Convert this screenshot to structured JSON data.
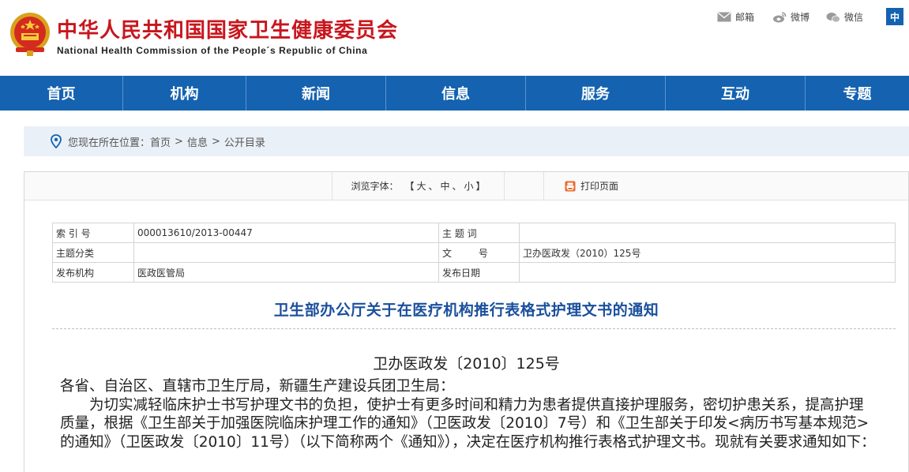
{
  "header": {
    "title": "中华人民共和国国家卫生健康委员会",
    "subtitle": "National Health Commission of the People´s Republic of China",
    "share": {
      "mail": "邮箱",
      "weibo": "微博",
      "wechat": "微信"
    },
    "lang": "中"
  },
  "nav": [
    "首页",
    "机构",
    "新闻",
    "信息",
    "服务",
    "互动",
    "专题"
  ],
  "breadcrumb": {
    "prefix": "您现在所在位置：",
    "items": [
      "首页",
      "信息",
      "公开目录"
    ],
    "separator": ">"
  },
  "toolbar": {
    "font_label": "浏览字体：",
    "open_bracket": "【",
    "large": "大",
    "medium": "中",
    "small": "小",
    "close_bracket": "】",
    "sep": "、",
    "print": "打印页面"
  },
  "meta": {
    "index_label": "索 引 号",
    "index_value": "000013610/2013-00447",
    "keyword_label": "主 题 词",
    "keyword_value": "",
    "category_label": "主题分类",
    "category_value": "",
    "docno_label": "文 号",
    "docno_value": "卫办医政发（2010）125号",
    "publisher_label": "发布机构",
    "publisher_value": "医政医管局",
    "date_label": "发布日期",
    "date_value": ""
  },
  "article": {
    "title": "卫生部办公厅关于在医疗机构推行表格式护理文书的通知",
    "doc_number": "卫办医政发〔2010〕125号",
    "greeting": "各省、自治区、直辖市卫生厅局，新疆生产建设兵团卫生局：",
    "paragraph1": "为切实减轻临床护士书写护理文书的负担，使护士有更多时间和精力为患者提供直接护理服务，密切护患关系，提高护理质量，根据《卫生部关于加强医院临床护理工作的通知》（卫医政发〔2010〕7号）和《卫生部关于印发<病历书写基本规范>的通知》（卫医政发〔2010〕11号）（以下简称两个《通知》），决定在医疗机构推行表格式护理文书。现就有关要求通知如下："
  },
  "colors": {
    "brand_red": "#c8161d",
    "nav_blue": "#1462b0",
    "title_blue": "#1a4f9c"
  }
}
